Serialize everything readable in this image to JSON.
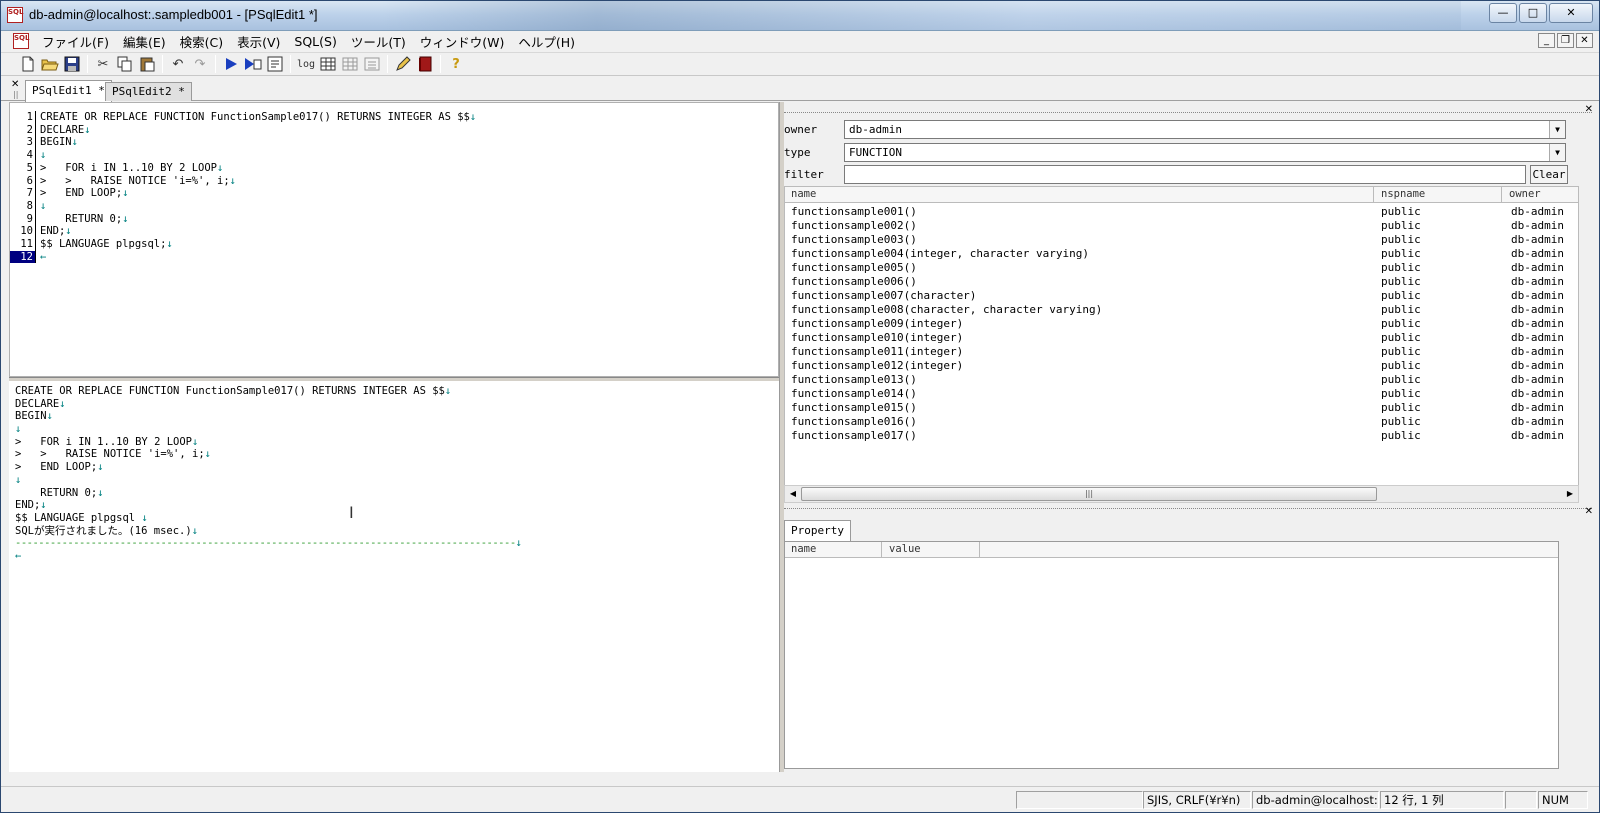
{
  "window": {
    "title": "db-admin@localhost:.sampledb001 - [PSqlEdit1 *]",
    "logo": "SQL"
  },
  "menu": [
    "ファイル(F)",
    "編集(E)",
    "検索(C)",
    "表示(V)",
    "SQL(S)",
    "ツール(T)",
    "ウィンドウ(W)",
    "ヘルプ(H)"
  ],
  "toolbar": {
    "log_label": "log"
  },
  "tabs": [
    {
      "label": "PSqlEdit1 *"
    },
    {
      "label": "PSqlEdit2 *"
    }
  ],
  "editor": {
    "current_line": "12",
    "lines": [
      {
        "num": "1",
        "text": "CREATE OR REPLACE FUNCTION FunctionSample017() RETURNS INTEGER AS $$",
        "mark": "↓"
      },
      {
        "num": "2",
        "text": "DECLARE",
        "mark": "↓"
      },
      {
        "num": "3",
        "text": "BEGIN",
        "mark": "↓"
      },
      {
        "num": "4",
        "text": "",
        "mark": "↓"
      },
      {
        "num": "5",
        "text": ">   FOR i IN 1..10 BY 2 LOOP",
        "mark": "↓"
      },
      {
        "num": "6",
        "text": ">   >   RAISE NOTICE 'i=%', i;",
        "mark": "↓"
      },
      {
        "num": "7",
        "text": ">   END LOOP;",
        "mark": "↓"
      },
      {
        "num": "8",
        "text": "",
        "mark": "↓"
      },
      {
        "num": "9",
        "text": "    RETURN 0;",
        "mark": "↓"
      },
      {
        "num": "10",
        "text": "END;",
        "mark": "↓"
      },
      {
        "num": "11",
        "text": "$$ LANGUAGE plpgsql;",
        "mark": "↓"
      },
      {
        "num": "12",
        "text": "",
        "mark": "←"
      }
    ]
  },
  "output": {
    "lines": [
      {
        "text": "CREATE OR REPLACE FUNCTION FunctionSample017() RETURNS INTEGER AS $$",
        "mark": "↓"
      },
      {
        "text": "DECLARE",
        "mark": "↓"
      },
      {
        "text": "BEGIN",
        "mark": "↓"
      },
      {
        "text": "",
        "mark": "↓"
      },
      {
        "text": ">   FOR i IN 1..10 BY 2 LOOP",
        "mark": "↓"
      },
      {
        "text": ">   >   RAISE NOTICE 'i=%', i;",
        "mark": "↓"
      },
      {
        "text": ">   END LOOP;",
        "mark": "↓"
      },
      {
        "text": "",
        "mark": "↓"
      },
      {
        "text": "    RETURN 0;",
        "mark": "↓"
      },
      {
        "text": "END;",
        "mark": "↓"
      },
      {
        "text": "$$ LANGUAGE plpgsql ",
        "mark": "↓"
      },
      {
        "text": "SQLが実行されました。(16 msec.)",
        "mark": "↓"
      }
    ],
    "end_mark": "←"
  },
  "object_browser": {
    "owner_label": "owner",
    "owner_value": "db-admin",
    "type_label": "type",
    "type_value": "FUNCTION",
    "filter_label": "filter",
    "filter_value": "",
    "clear_label": "Clear",
    "columns": [
      "name",
      "nspname",
      "owner"
    ],
    "rows": [
      {
        "name": "functionsample001()",
        "nspname": "public",
        "owner": "db-admin"
      },
      {
        "name": "functionsample002()",
        "nspname": "public",
        "owner": "db-admin"
      },
      {
        "name": "functionsample003()",
        "nspname": "public",
        "owner": "db-admin"
      },
      {
        "name": "functionsample004(integer, character varying)",
        "nspname": "public",
        "owner": "db-admin"
      },
      {
        "name": "functionsample005()",
        "nspname": "public",
        "owner": "db-admin"
      },
      {
        "name": "functionsample006()",
        "nspname": "public",
        "owner": "db-admin"
      },
      {
        "name": "functionsample007(character)",
        "nspname": "public",
        "owner": "db-admin"
      },
      {
        "name": "functionsample008(character, character varying)",
        "nspname": "public",
        "owner": "db-admin"
      },
      {
        "name": "functionsample009(integer)",
        "nspname": "public",
        "owner": "db-admin"
      },
      {
        "name": "functionsample010(integer)",
        "nspname": "public",
        "owner": "db-admin"
      },
      {
        "name": "functionsample011(integer)",
        "nspname": "public",
        "owner": "db-admin"
      },
      {
        "name": "functionsample012(integer)",
        "nspname": "public",
        "owner": "db-admin"
      },
      {
        "name": "functionsample013()",
        "nspname": "public",
        "owner": "db-admin"
      },
      {
        "name": "functionsample014()",
        "nspname": "public",
        "owner": "db-admin"
      },
      {
        "name": "functionsample015()",
        "nspname": "public",
        "owner": "db-admin"
      },
      {
        "name": "functionsample016()",
        "nspname": "public",
        "owner": "db-admin"
      },
      {
        "name": "functionsample017()",
        "nspname": "public",
        "owner": "db-admin"
      }
    ]
  },
  "property": {
    "tab_label": "Property",
    "columns": [
      "name",
      "value"
    ]
  },
  "status": {
    "encoding": "SJIS, CRLF(¥r¥n)",
    "connection": "db-admin@localhost:",
    "position": "12 行, 1 列",
    "num": "NUM"
  }
}
